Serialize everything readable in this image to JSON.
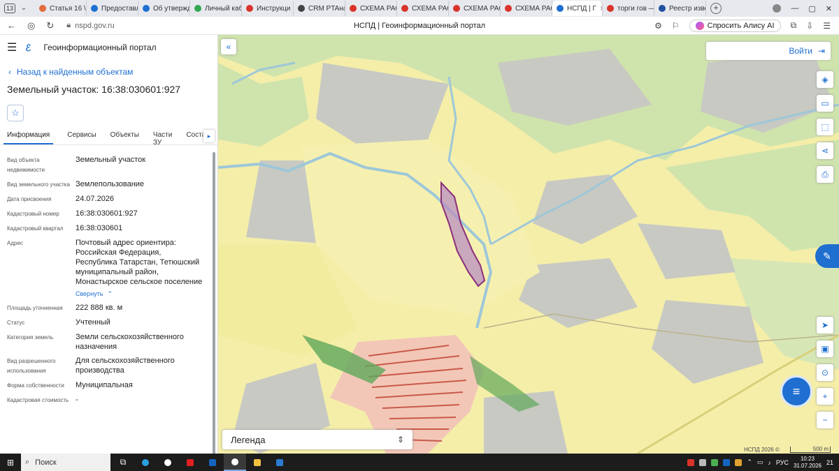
{
  "browser": {
    "tab_count": "13",
    "tabs": [
      {
        "label": "Статья 16 \\",
        "color": "#e36b3d"
      },
      {
        "label": "Предоставл",
        "color": "#1f6fd0"
      },
      {
        "label": "Об утвержд",
        "color": "#1f6fd0"
      },
      {
        "label": "Личный каб",
        "color": "#33a852"
      },
      {
        "label": "Инструкци",
        "color": "#d9342b"
      },
      {
        "label": "CRM PTAнал",
        "color": "#444"
      },
      {
        "label": "СХЕМА РАС",
        "color": "#d9342b"
      },
      {
        "label": "СХЕМА РАС",
        "color": "#d9342b"
      },
      {
        "label": "СХЕМА РАС",
        "color": "#d9342b"
      },
      {
        "label": "СХЕМА РАС",
        "color": "#d9342b"
      },
      {
        "label": "НСПД | Г",
        "color": "#1f6fd0",
        "active": true
      },
      {
        "label": "торги гов —",
        "color": "#d9342b"
      },
      {
        "label": "Реестр изве",
        "color": "#1f4fa0"
      }
    ],
    "url": "nspd.gov.ru",
    "page_title": "НСПД | Геоинформационный портал",
    "alisa_label": "Спросить Алису AI"
  },
  "panel": {
    "app_title": "Геоинформационный портал",
    "back_label": "Назад к найденным объектам",
    "object_title": "Земельный участок: 16:38:030601:927",
    "tabs": [
      "Информация",
      "Сервисы",
      "Объекты",
      "Части ЗУ",
      "Состав"
    ],
    "props": [
      {
        "label": "Вид объекта недвижимости",
        "value": "Земельный участок"
      },
      {
        "label": "Вид земельного участка",
        "value": "Землепользование"
      },
      {
        "label": "Дата присвоения",
        "value": "24.07.2026"
      },
      {
        "label": "Кадастровый номер",
        "value": "16:38:030601:927"
      },
      {
        "label": "Кадастровый квартал",
        "value": "16:38:030601"
      },
      {
        "label": "Адрес",
        "value": "Почтовый адрес ориентира: Российская Федерация, Республика Татарстан, Тетюшский муниципальный район, Монастырское сельское поселение"
      },
      {
        "label": "Площадь уточненная",
        "value": "222 888 кв. м"
      },
      {
        "label": "Статус",
        "value": "Учтенный"
      },
      {
        "label": "Категория земель",
        "value": "Земли сельскохозяйственного назначения"
      },
      {
        "label": "Вид разрешенного использования",
        "value": "Для сельскохозяйственного производства"
      },
      {
        "label": "Форма собственности",
        "value": "Муниципальная"
      },
      {
        "label": "Кадастровая стоимость",
        "value": "-"
      }
    ],
    "collapse_label": "Свернуть"
  },
  "map": {
    "login_label": "Войти",
    "legend_label": "Легенда",
    "copyright": "НСПД 2026 ©",
    "scale_label": "500 m",
    "highlight_color": "#b98fc0"
  },
  "taskbar": {
    "search_label": "Поиск",
    "lang": "РУС",
    "time": "10:23",
    "date": "31.07.2026",
    "notifications": "21"
  }
}
